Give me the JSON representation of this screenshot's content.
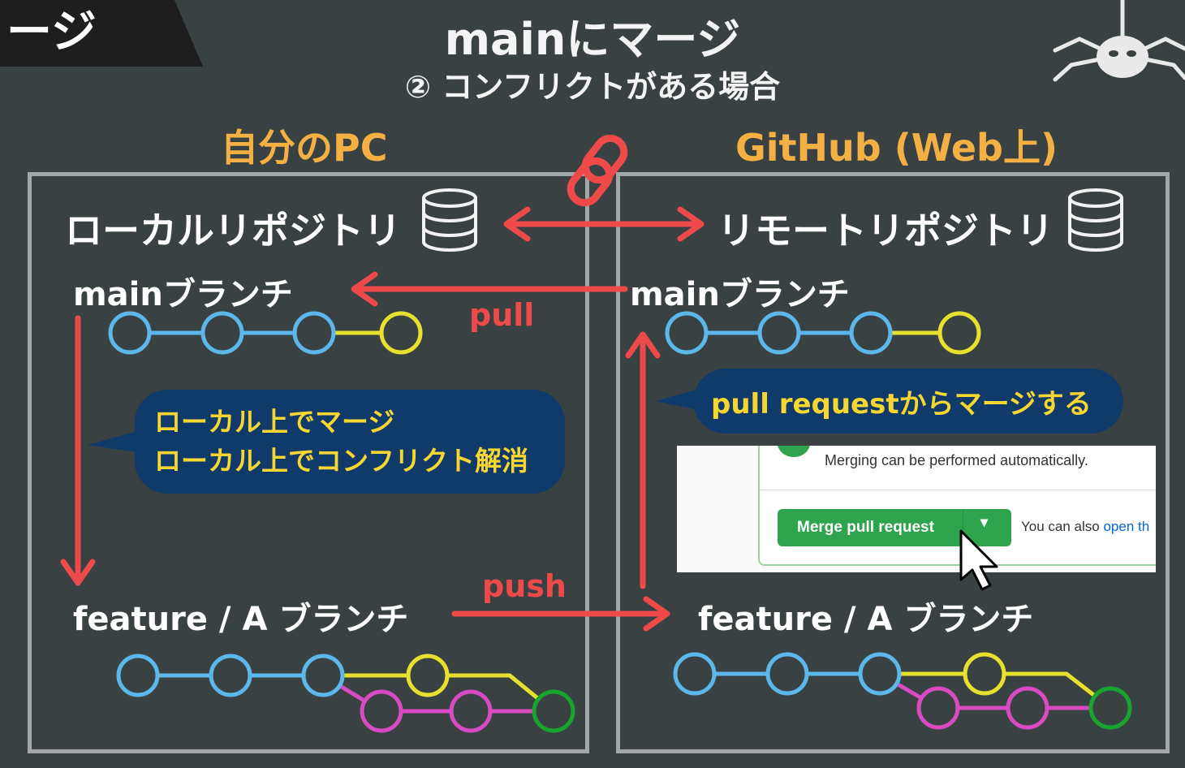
{
  "corner_tab": {
    "text": "ージ"
  },
  "title": {
    "main": "mainにマージ",
    "sub": "② コンフリクトがある場合"
  },
  "left_panel": {
    "header": "自分のPC",
    "repo_label": "ローカルリポジトリ",
    "main_branch": "mainブランチ",
    "feature_branch": "feature / A ブランチ",
    "bubble_lines": [
      "ローカル上でマージ",
      "ローカル上でコンフリクト解消"
    ]
  },
  "right_panel": {
    "header": "GitHub (Web上)",
    "repo_label": "リモートリポジトリ",
    "main_branch": "mainブランチ",
    "feature_branch": "feature / A ブランチ",
    "bubble": "pull requestからマージする"
  },
  "arrows": {
    "pull_label": "pull",
    "push_label": "push"
  },
  "github_screenshot": {
    "status_message": "Merging can be performed automatically.",
    "merge_button": "Merge pull request",
    "also_text": "You can also ",
    "also_link": "open th"
  },
  "icons": [
    "database-icon",
    "chain-link-icon",
    "spider-icon",
    "mouse-cursor-icon"
  ],
  "colors": {
    "background": "#3a4143",
    "header_orange": "#f5b044",
    "arrow_red": "#ef4a4a",
    "bubble_bg": "#0f3a6a",
    "bubble_text": "#f7d631",
    "commit_blue": "#5cb7ea",
    "commit_yellow": "#e6e12c",
    "commit_magenta": "#d94bc2",
    "commit_green": "#17a52e",
    "merge_button": "#2ea44f"
  }
}
